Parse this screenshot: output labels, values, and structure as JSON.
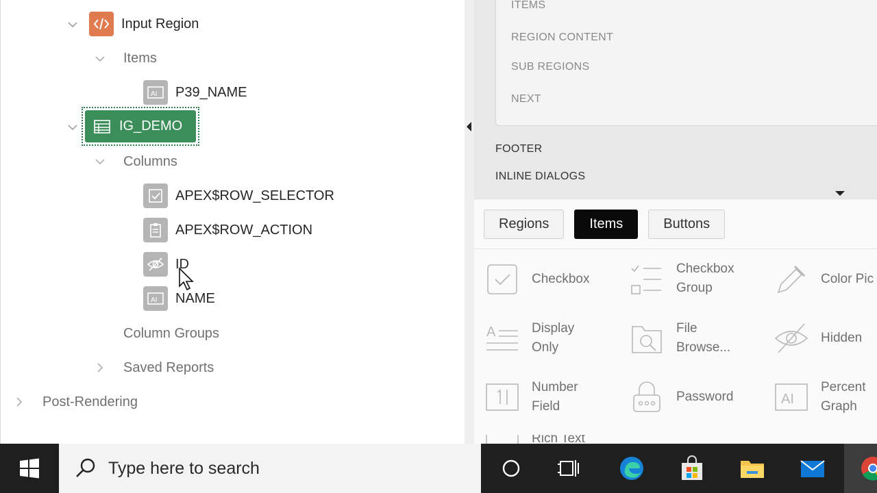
{
  "tree": {
    "input_region": "Input Region",
    "items_folder": "Items",
    "p39_name": "P39_NAME",
    "ig_demo": "IG_DEMO",
    "columns_folder": "Columns",
    "row_selector": "APEX$ROW_SELECTOR",
    "row_action": "APEX$ROW_ACTION",
    "id": "ID",
    "name": "NAME",
    "column_groups": "Column Groups",
    "saved_reports": "Saved Reports",
    "post_rendering": "Post-Rendering"
  },
  "layout": {
    "slots": [
      "ITEMS",
      "REGION CONTENT",
      "SUB REGIONS",
      "NEXT"
    ],
    "footer": "FOOTER",
    "inline_dialogs": "INLINE DIALOGS"
  },
  "gallery": {
    "tabs": [
      {
        "label": "Regions",
        "active": false
      },
      {
        "label": "Items",
        "active": true
      },
      {
        "label": "Buttons",
        "active": false
      }
    ],
    "items": {
      "checkbox": "Checkbox",
      "checkbox_group_1": "Checkbox",
      "checkbox_group_2": "Group",
      "color_picker": "Color Pic",
      "display_only_1": "Display",
      "display_only_2": "Only",
      "file_browse_1": "File",
      "file_browse_2": "Browse...",
      "hidden": "Hidden",
      "number_field_1": "Number",
      "number_field_2": "Field",
      "password": "Password",
      "percent_graph_1": "Percent",
      "percent_graph_2": "Graph",
      "rich_text": "Rich Text"
    }
  },
  "taskbar": {
    "search_placeholder": "Type here to search"
  },
  "colors": {
    "selected_node": "#3b8e5a",
    "region_icon": "#e07a4f",
    "taskbar": "#1f1f1f"
  }
}
